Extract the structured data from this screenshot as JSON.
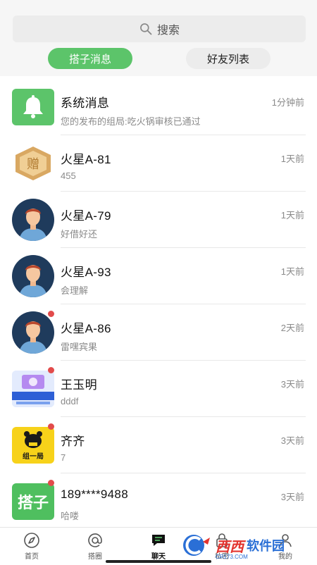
{
  "search": {
    "label": "搜索"
  },
  "tabs": [
    {
      "label": "搭子消息",
      "active": true
    },
    {
      "label": "好友列表",
      "active": false
    }
  ],
  "messages": [
    {
      "name": "系统消息",
      "preview": "您的发布的组局:吃火锅审核已通过",
      "time": "1分钟前",
      "avatar": "bell-icon",
      "unread": false
    },
    {
      "name": "火星A-81",
      "preview": "455",
      "time": "1天前",
      "avatar": "gift-badge",
      "badge_text": "赠",
      "unread": false
    },
    {
      "name": "火星A-79",
      "preview": "好借好还",
      "time": "1天前",
      "avatar": "person-avatar",
      "unread": false
    },
    {
      "name": "火星A-93",
      "preview": "会理解",
      "time": "1天前",
      "avatar": "person-avatar",
      "unread": false
    },
    {
      "name": "火星A-86",
      "preview": "雷嘿宾果",
      "time": "2天前",
      "avatar": "person-avatar",
      "unread": true
    },
    {
      "name": "王玉明",
      "preview": "dddf",
      "time": "3天前",
      "avatar": "promo-image",
      "unread": true
    },
    {
      "name": "齐齐",
      "preview": "7",
      "time": "3天前",
      "avatar": "bear-logo",
      "badge_text": "组一局",
      "unread": true
    },
    {
      "name": "189****9488",
      "preview": "哈喽",
      "time": "3天前",
      "avatar": "text-logo",
      "badge_text": "搭子",
      "unread": true
    }
  ],
  "tabbar": [
    {
      "label": "首页",
      "icon": "compass-icon",
      "active": false
    },
    {
      "label": "搭圈",
      "icon": "at-icon",
      "active": false
    },
    {
      "label": "聊天",
      "icon": "chat-icon",
      "active": true
    },
    {
      "label": "私密",
      "icon": "lock-icon",
      "active": false
    },
    {
      "label": "我的",
      "icon": "user-icon",
      "active": false
    }
  ],
  "watermark": {
    "text": "西西",
    "text2": "软件园",
    "sub": "CR173.COM"
  },
  "colors": {
    "accent": "#5cc46a",
    "unread": "#e24b4b",
    "avatar_bg": "#1f3b5c"
  }
}
